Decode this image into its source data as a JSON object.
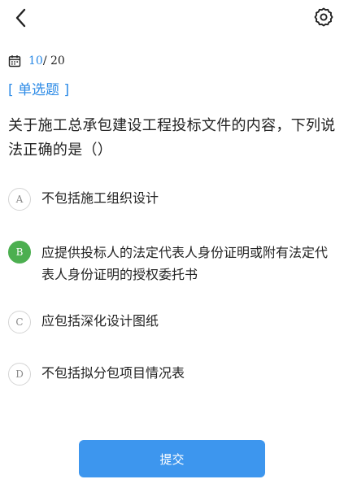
{
  "header": {
    "back_icon": "chevron-left-icon",
    "settings_icon": "gear-icon"
  },
  "progress": {
    "icon": "calendar-icon",
    "current": "10",
    "separator": "/",
    "total": " 20"
  },
  "question": {
    "type_label": "[ 单选题 ]",
    "text": "关于施工总承包建设工程投标文件的内容，下列说法正确的是（）"
  },
  "options": [
    {
      "letter": "A",
      "text": "不包括施工组织设计",
      "selected": false
    },
    {
      "letter": "B",
      "text": "应提供投标人的法定代表人身份证明或附有法定代表人身份证明的授权委托书",
      "selected": true
    },
    {
      "letter": "C",
      "text": "应包括深化设计图纸",
      "selected": false
    },
    {
      "letter": "D",
      "text": "不包括拟分包项目情况表",
      "selected": false
    }
  ],
  "submit_label": "提交",
  "colors": {
    "accent_blue": "#2b8ae6",
    "button_blue": "#3d96ee",
    "selected_green": "#4caf50"
  }
}
